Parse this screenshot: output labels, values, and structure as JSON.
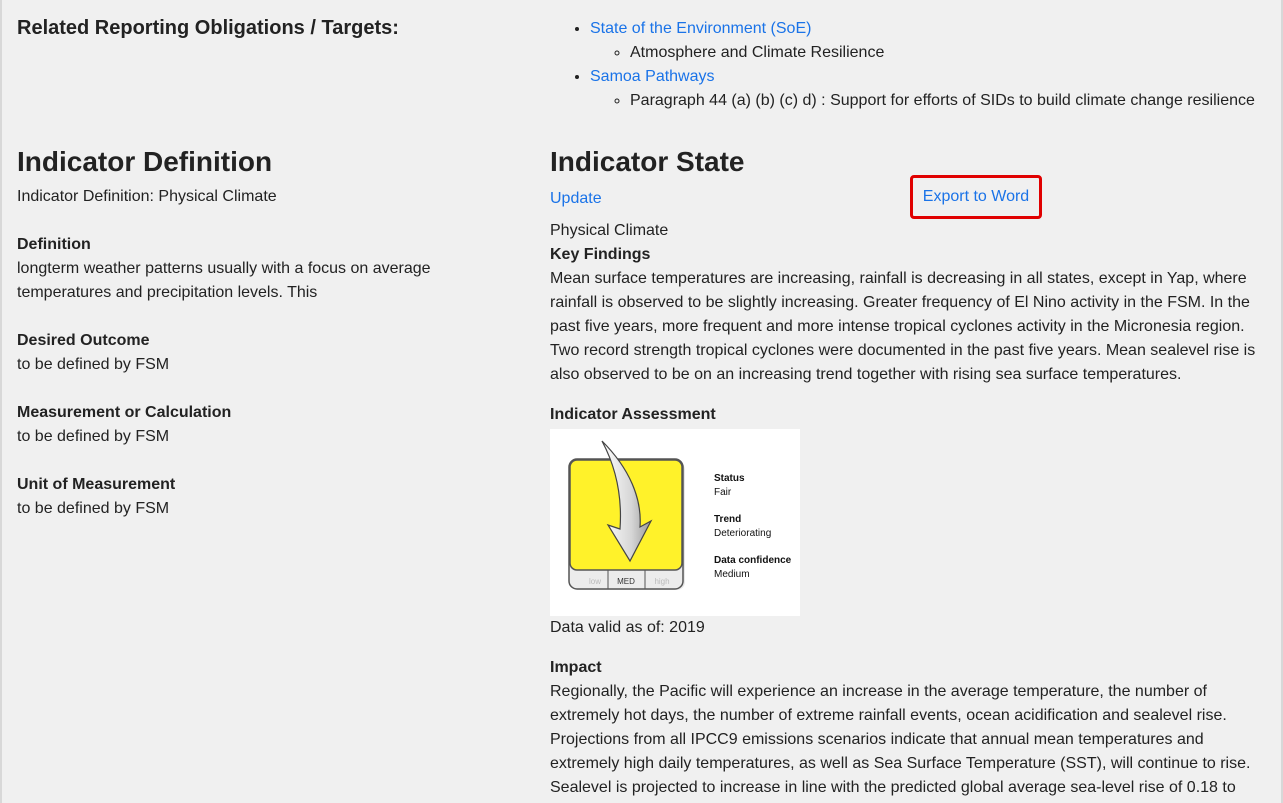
{
  "obligations": {
    "heading": "Related Reporting Obligations / Targets:",
    "items": [
      {
        "label": "State of the Environment (SoE)",
        "sub": "Atmosphere and Climate Resilience"
      },
      {
        "label": "Samoa Pathways",
        "sub": "Paragraph 44 (a) (b) (c) d) : Support for efforts of SIDs to build climate change resilience"
      }
    ]
  },
  "definition": {
    "heading": "Indicator Definition",
    "intro": "Indicator Definition: Physical Climate",
    "definition_label": "Definition",
    "definition_text": "longterm weather patterns usually with a focus on average temperatures and precipitation levels. This",
    "outcome_label": "Desired Outcome",
    "outcome_text": "to be defined by FSM",
    "measurement_label": "Measurement or Calculation",
    "measurement_text": "to be defined by FSM",
    "unit_label": "Unit of Measurement",
    "unit_text": "to be defined by FSM"
  },
  "state": {
    "heading": "Indicator State",
    "update_label": "Update",
    "export_label": "Export to Word",
    "title": "Physical Climate",
    "key_findings_label": "Key Findings",
    "key_findings_text": "Mean surface temperatures are increasing, rainfall is decreasing in all states, except in Yap, where rainfall is observed to be slightly increasing. Greater frequency of El Nino activity in the FSM. In the past five years, more frequent and more intense tropical cyclones activity in the Micronesia region. Two record strength tropical cyclones were documented in the past five years. Mean sealevel rise is also observed to be on an increasing trend together with rising sea surface temperatures.",
    "assessment_label": "Indicator Assessment",
    "assessment": {
      "status_label": "Status",
      "status_value": "Fair",
      "trend_label": "Trend",
      "trend_value": "Deteriorating",
      "confidence_label": "Data confidence",
      "confidence_value": "Medium",
      "scale": [
        "low",
        "MED",
        "high"
      ],
      "box_color": "#fff22a",
      "arrow_icon": "down-arrow-icon"
    },
    "valid_text": "Data valid as of: 2019",
    "impact_label": "Impact",
    "impact_text": "Regionally, the Pacific will experience an increase in the average temperature, the number of extremely hot days, the number of extreme rainfall events, ocean acidification and sealevel rise. Projections from all IPCC9 emissions scenarios indicate that annual mean temperatures and extremely high daily temperatures, as well as Sea Surface Temperature (SST), will continue to rise. Sealevel is projected to increase in line with the predicted global average sea-level rise of 0.18 to"
  }
}
